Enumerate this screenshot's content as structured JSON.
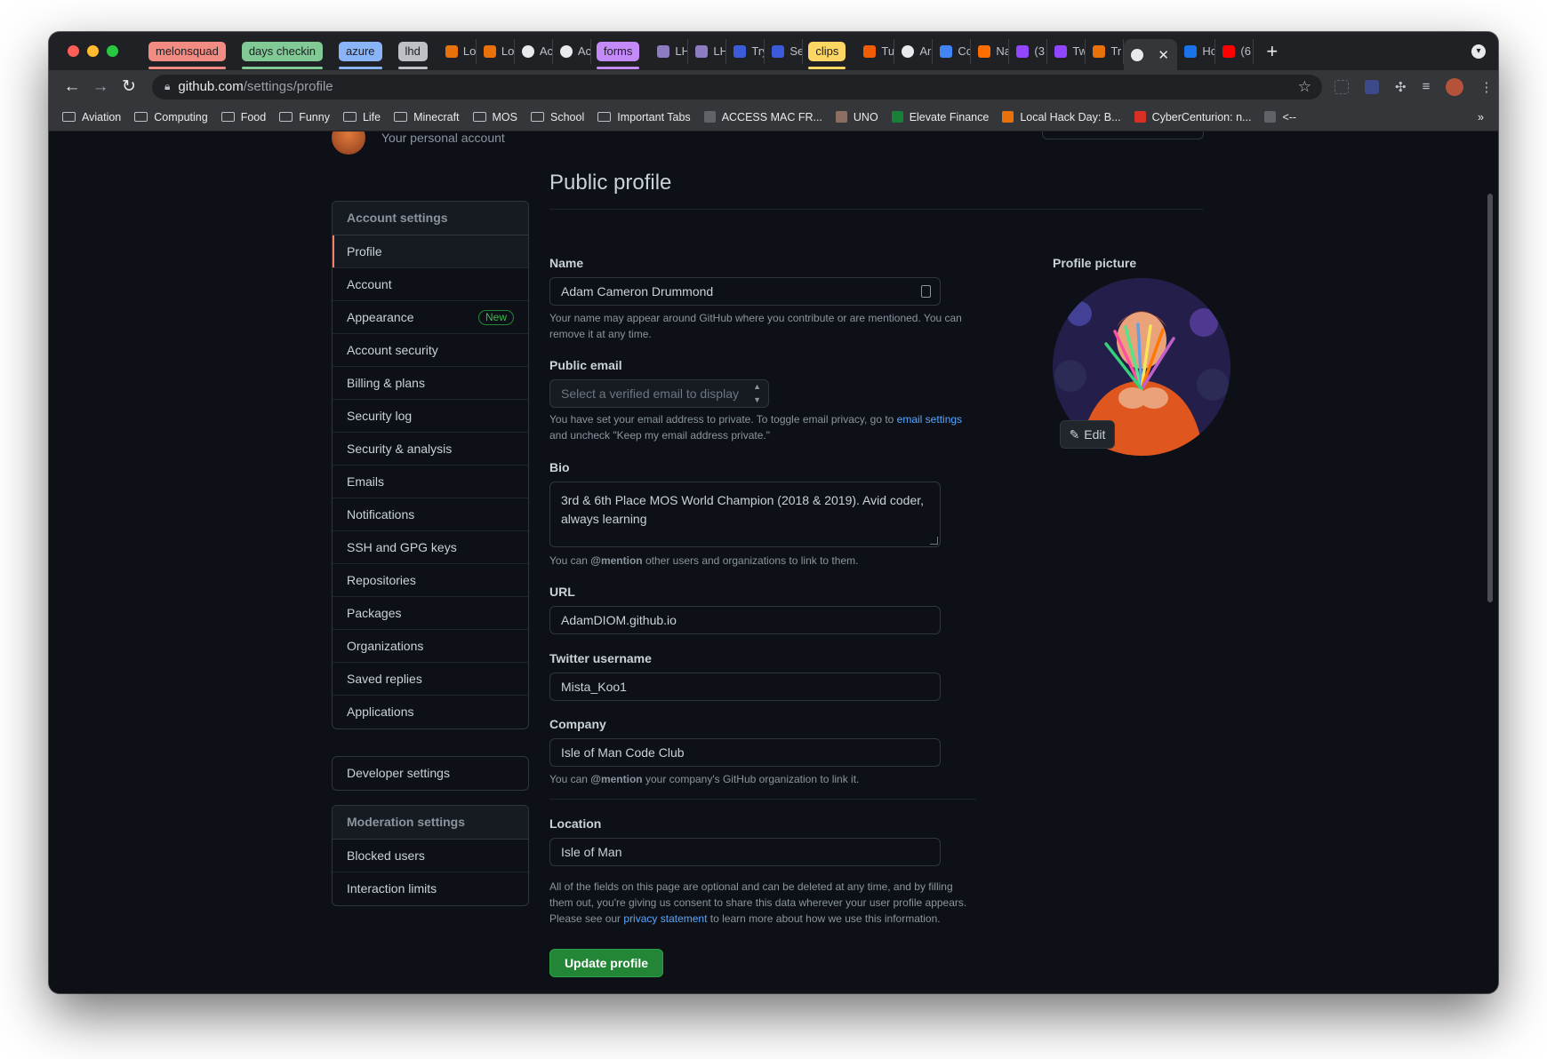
{
  "browser": {
    "tab_groups": [
      {
        "label": "melonsquad",
        "color": "#f28b82"
      },
      {
        "label": "days checkin",
        "color": "#81c995"
      },
      {
        "label": "azure",
        "color": "#8ab4f8"
      },
      {
        "label": "lhd",
        "color": "#bdc1c6"
      },
      {
        "label": "forms",
        "color": "#c58af9"
      },
      {
        "label": "clips",
        "color": "#fdd663"
      }
    ],
    "tabs": [
      {
        "title": "Lo",
        "icon": "hack-icon"
      },
      {
        "title": "Lo",
        "icon": "hack-icon"
      },
      {
        "title": "Ac",
        "icon": "github-icon"
      },
      {
        "title": "Ac",
        "icon": "github-icon"
      },
      {
        "title": "LH",
        "icon": "list-icon"
      },
      {
        "title": "LH",
        "icon": "list-icon"
      },
      {
        "title": "Try",
        "icon": "d-icon"
      },
      {
        "title": "Se",
        "icon": "d-icon"
      },
      {
        "title": "Tu",
        "icon": "orange-icon"
      },
      {
        "title": "Ar",
        "icon": "github-icon"
      },
      {
        "title": "Cc",
        "icon": "cloud-icon"
      },
      {
        "title": "Na",
        "icon": "chart-icon"
      },
      {
        "title": "(3",
        "icon": "twitch-icon"
      },
      {
        "title": "Tw",
        "icon": "twitch-icon"
      },
      {
        "title": "Tr",
        "icon": "hack-icon"
      },
      {
        "title": "",
        "icon": "github-icon",
        "active": true
      },
      {
        "title": "Hc",
        "icon": "a-icon"
      },
      {
        "title": "(6",
        "icon": "youtube-icon"
      }
    ],
    "url_host": "github.com",
    "url_path": "/settings/profile",
    "bookmarks": [
      {
        "label": "Aviation",
        "type": "folder"
      },
      {
        "label": "Computing",
        "type": "folder"
      },
      {
        "label": "Food",
        "type": "folder"
      },
      {
        "label": "Funny",
        "type": "folder"
      },
      {
        "label": "Life",
        "type": "folder"
      },
      {
        "label": "Minecraft",
        "type": "folder"
      },
      {
        "label": "MOS",
        "type": "folder"
      },
      {
        "label": "School",
        "type": "folder"
      },
      {
        "label": "Important Tabs",
        "type": "folder"
      },
      {
        "label": "ACCESS MAC FR...",
        "type": "site"
      },
      {
        "label": "UNO",
        "type": "site"
      },
      {
        "label": "Elevate Finance",
        "type": "site"
      },
      {
        "label": "Local Hack Day: B...",
        "type": "site"
      },
      {
        "label": "CyberCenturion: n...",
        "type": "site"
      },
      {
        "label": "<--",
        "type": "site"
      }
    ],
    "bookmarks_more": "»"
  },
  "header": {
    "subtitle": "Your personal account"
  },
  "sidebar": {
    "heading": "Account settings",
    "items": [
      {
        "label": "Profile",
        "selected": true
      },
      {
        "label": "Account"
      },
      {
        "label": "Appearance",
        "badge": "New"
      },
      {
        "label": "Account security"
      },
      {
        "label": "Billing & plans"
      },
      {
        "label": "Security log"
      },
      {
        "label": "Security & analysis"
      },
      {
        "label": "Emails"
      },
      {
        "label": "Notifications"
      },
      {
        "label": "SSH and GPG keys"
      },
      {
        "label": "Repositories"
      },
      {
        "label": "Packages"
      },
      {
        "label": "Organizations"
      },
      {
        "label": "Saved replies"
      },
      {
        "label": "Applications"
      }
    ],
    "developer": "Developer settings",
    "moderation_heading": "Moderation settings",
    "moderation_items": [
      {
        "label": "Blocked users"
      },
      {
        "label": "Interaction limits"
      }
    ]
  },
  "main": {
    "title": "Public profile",
    "name_label": "Name",
    "name_value": "Adam Cameron Drummond",
    "name_note": "Your name may appear around GitHub where you contribute or are mentioned. You can remove it at any time.",
    "email_label": "Public email",
    "email_placeholder": "Select a verified email to display",
    "email_note_before": "You have set your email address to private. To toggle email privacy, go to ",
    "email_note_link": "email settings",
    "email_note_after": " and uncheck \"Keep my email address private.\"",
    "bio_label": "Bio",
    "bio_value": "3rd & 6th Place MOS World Champion (2018 & 2019). Avid coder, always learning",
    "bio_note_before": "You can ",
    "bio_note_mention": "@mention",
    "bio_note_after": " other users and organizations to link to them.",
    "url_label": "URL",
    "url_value": "AdamDIOM.github.io",
    "twitter_label": "Twitter username",
    "twitter_value": "Mista_Koo1",
    "company_label": "Company",
    "company_value": "Isle of Man Code Club",
    "company_note_before": "You can ",
    "company_note_mention": "@mention",
    "company_note_after": " your company's GitHub organization to link it.",
    "location_label": "Location",
    "location_value": "Isle of Man",
    "consent_before": "All of the fields on this page are optional and can be deleted at any time, and by filling them out, you're giving us consent to share this data wherever your user profile appears. Please see our ",
    "consent_link": "privacy statement",
    "consent_after": " to learn more about how we use this information.",
    "update_button": "Update profile",
    "picture_label": "Profile picture",
    "edit_button": "Edit"
  },
  "colors": {
    "accent_link": "#58a6ff",
    "primary_button": "#238636",
    "selected_marker": "#f78166",
    "background": "#0d1117"
  }
}
